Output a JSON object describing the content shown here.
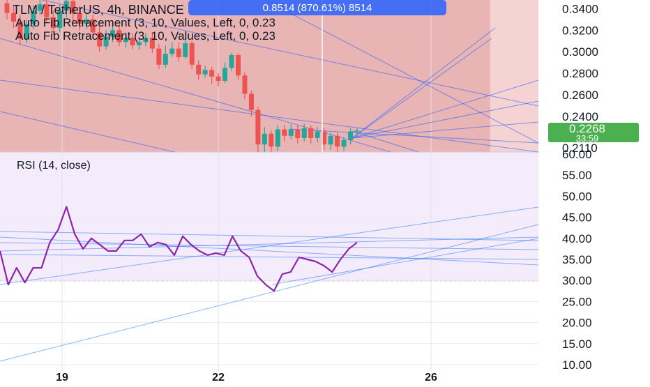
{
  "symbol": {
    "pair": "TLM / TetherUS",
    "interval": "4h",
    "exchange": "BINANCE"
  },
  "indicators": [
    "Auto Fib Retracement (3, 10, Values, Left, 0, 0.23",
    "Auto Fib Retracement (3, 10, Values, Left, 0, 0.23"
  ],
  "tooltip": "0.8514 (870.61%) 8514",
  "price_badge": {
    "price": "0.2268",
    "countdown": "33:59"
  },
  "rsi_label": "RSI (14, close)",
  "colors": {
    "up": "#26a69a",
    "down": "#ef5350",
    "rsi": "#8e24aa",
    "fib_zone": "#e8b4b4",
    "rsi_band": "#f4ecfb",
    "badge": "#4caf50",
    "tooltip": "#2962ff",
    "trend": "#2962ff"
  },
  "chart_data": [
    {
      "type": "candlestick",
      "title": "TLM / TetherUS, 4h, BINANCE",
      "y_axis_ticks": [
        "0.3400",
        "0.3200",
        "0.3000",
        "0.2800",
        "0.2600",
        "0.2400",
        "0.2110"
      ],
      "ylim": [
        0.207,
        0.348
      ],
      "last_price": 0.2268,
      "candles": [
        {
          "o": 0.345,
          "c": 0.336,
          "h": 0.349,
          "l": 0.33
        },
        {
          "o": 0.336,
          "c": 0.328,
          "h": 0.342,
          "l": 0.322
        },
        {
          "o": 0.328,
          "c": 0.312,
          "h": 0.334,
          "l": 0.306
        },
        {
          "o": 0.312,
          "c": 0.326,
          "h": 0.33,
          "l": 0.308
        },
        {
          "o": 0.326,
          "c": 0.338,
          "h": 0.343,
          "l": 0.321
        },
        {
          "o": 0.338,
          "c": 0.344,
          "h": 0.348,
          "l": 0.334
        },
        {
          "o": 0.344,
          "c": 0.332,
          "h": 0.348,
          "l": 0.327
        },
        {
          "o": 0.332,
          "c": 0.322,
          "h": 0.338,
          "l": 0.316
        },
        {
          "o": 0.322,
          "c": 0.338,
          "h": 0.344,
          "l": 0.318
        },
        {
          "o": 0.338,
          "c": 0.347,
          "h": 0.35,
          "l": 0.332
        },
        {
          "o": 0.347,
          "c": 0.336,
          "h": 0.35,
          "l": 0.328
        },
        {
          "o": 0.336,
          "c": 0.326,
          "h": 0.342,
          "l": 0.32
        },
        {
          "o": 0.326,
          "c": 0.33,
          "h": 0.336,
          "l": 0.321
        },
        {
          "o": 0.33,
          "c": 0.318,
          "h": 0.334,
          "l": 0.312
        },
        {
          "o": 0.318,
          "c": 0.305,
          "h": 0.324,
          "l": 0.3
        },
        {
          "o": 0.305,
          "c": 0.314,
          "h": 0.32,
          "l": 0.302
        },
        {
          "o": 0.314,
          "c": 0.32,
          "h": 0.325,
          "l": 0.309
        },
        {
          "o": 0.32,
          "c": 0.309,
          "h": 0.325,
          "l": 0.305
        },
        {
          "o": 0.309,
          "c": 0.313,
          "h": 0.318,
          "l": 0.304
        },
        {
          "o": 0.313,
          "c": 0.306,
          "h": 0.317,
          "l": 0.302
        },
        {
          "o": 0.306,
          "c": 0.309,
          "h": 0.312,
          "l": 0.302
        },
        {
          "o": 0.309,
          "c": 0.313,
          "h": 0.317,
          "l": 0.305
        },
        {
          "o": 0.313,
          "c": 0.303,
          "h": 0.318,
          "l": 0.299
        },
        {
          "o": 0.303,
          "c": 0.288,
          "h": 0.307,
          "l": 0.284
        },
        {
          "o": 0.288,
          "c": 0.298,
          "h": 0.306,
          "l": 0.285
        },
        {
          "o": 0.298,
          "c": 0.303,
          "h": 0.309,
          "l": 0.295
        },
        {
          "o": 0.303,
          "c": 0.295,
          "h": 0.309,
          "l": 0.291
        },
        {
          "o": 0.295,
          "c": 0.308,
          "h": 0.313,
          "l": 0.293
        },
        {
          "o": 0.308,
          "c": 0.288,
          "h": 0.31,
          "l": 0.284
        },
        {
          "o": 0.288,
          "c": 0.279,
          "h": 0.292,
          "l": 0.274
        },
        {
          "o": 0.279,
          "c": 0.283,
          "h": 0.287,
          "l": 0.276
        },
        {
          "o": 0.283,
          "c": 0.277,
          "h": 0.286,
          "l": 0.27
        },
        {
          "o": 0.277,
          "c": 0.273,
          "h": 0.28,
          "l": 0.268
        },
        {
          "o": 0.273,
          "c": 0.285,
          "h": 0.29,
          "l": 0.271
        },
        {
          "o": 0.285,
          "c": 0.297,
          "h": 0.299,
          "l": 0.282
        },
        {
          "o": 0.297,
          "c": 0.278,
          "h": 0.299,
          "l": 0.274
        },
        {
          "o": 0.278,
          "c": 0.261,
          "h": 0.281,
          "l": 0.256
        },
        {
          "o": 0.261,
          "c": 0.246,
          "h": 0.264,
          "l": 0.24
        },
        {
          "o": 0.246,
          "c": 0.214,
          "h": 0.249,
          "l": 0.205
        },
        {
          "o": 0.214,
          "c": 0.224,
          "h": 0.23,
          "l": 0.207
        },
        {
          "o": 0.224,
          "c": 0.212,
          "h": 0.227,
          "l": 0.206
        },
        {
          "o": 0.212,
          "c": 0.228,
          "h": 0.232,
          "l": 0.208
        },
        {
          "o": 0.228,
          "c": 0.222,
          "h": 0.232,
          "l": 0.217
        },
        {
          "o": 0.222,
          "c": 0.228,
          "h": 0.233,
          "l": 0.219
        },
        {
          "o": 0.228,
          "c": 0.22,
          "h": 0.232,
          "l": 0.215
        },
        {
          "o": 0.22,
          "c": 0.229,
          "h": 0.233,
          "l": 0.217
        },
        {
          "o": 0.229,
          "c": 0.22,
          "h": 0.232,
          "l": 0.215
        },
        {
          "o": 0.22,
          "c": 0.226,
          "h": 0.23,
          "l": 0.216
        },
        {
          "o": 0.226,
          "c": 0.214,
          "h": 0.229,
          "l": 0.209
        },
        {
          "o": 0.214,
          "c": 0.222,
          "h": 0.225,
          "l": 0.209
        },
        {
          "o": 0.222,
          "c": 0.212,
          "h": 0.225,
          "l": 0.207
        },
        {
          "o": 0.212,
          "c": 0.218,
          "h": 0.221,
          "l": 0.208
        },
        {
          "o": 0.218,
          "c": 0.226,
          "h": 0.229,
          "l": 0.214
        },
        {
          "o": 0.226,
          "c": 0.227,
          "h": 0.23,
          "l": 0.221
        }
      ]
    },
    {
      "type": "line",
      "title": "RSI (14, close)",
      "y_axis_ticks": [
        "60.00",
        "55.00",
        "50.00",
        "45.00",
        "40.00",
        "35.00",
        "30.00",
        "25.00",
        "20.00",
        "15.00",
        "10.00"
      ],
      "ylim": [
        8.5,
        60.5
      ],
      "x_axis_ticks": [
        "19",
        "22",
        "26"
      ],
      "series": [
        {
          "values": [
            37,
            29,
            33,
            29.5,
            33,
            33,
            39,
            42,
            47.5,
            41,
            37.5,
            40,
            38.5,
            37,
            37,
            39.5,
            39.5,
            41,
            38,
            39,
            38.5,
            36,
            40.5,
            38.5,
            37,
            36,
            36.5,
            36,
            40.5,
            37,
            35.5,
            31,
            29,
            27.5,
            31.5,
            32,
            35.5,
            35,
            34.5,
            33.5,
            32,
            35,
            37.5,
            39
          ]
        }
      ]
    }
  ]
}
